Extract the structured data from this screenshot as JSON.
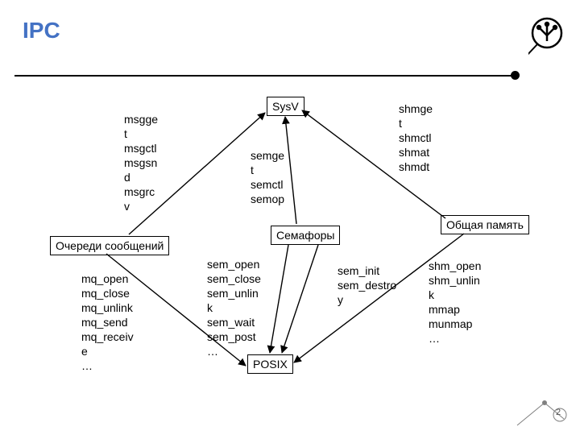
{
  "title": "IPC",
  "page_number": "2",
  "nodes": {
    "sysv": "SysV",
    "posix": "POSIX",
    "msgq": "Очереди сообщений",
    "sem": "Семафоры",
    "shm": "Общая память"
  },
  "labels": {
    "sysv_msgq": "msgge\nt\nmsgctl\nmsgsn\nd\nmsgrc\nv",
    "sysv_sem": "semge\nt\nsemctl\nsemop",
    "sysv_shm": "shmge\nt\nshmctl\nshmat\nshmdt",
    "posix_msgq": "mq_open\nmq_close\nmq_unlink\nmq_send\nmq_receiv\ne\n…",
    "posix_sem_named": "sem_open\nsem_close\nsem_unlin\nk\nsem_wait\nsem_post\n…",
    "posix_sem_unnamed": "sem_init\nsem_destro\ny",
    "posix_shm": "shm_open\nshm_unlin\nk\nmmap\nmunmap\n…"
  }
}
